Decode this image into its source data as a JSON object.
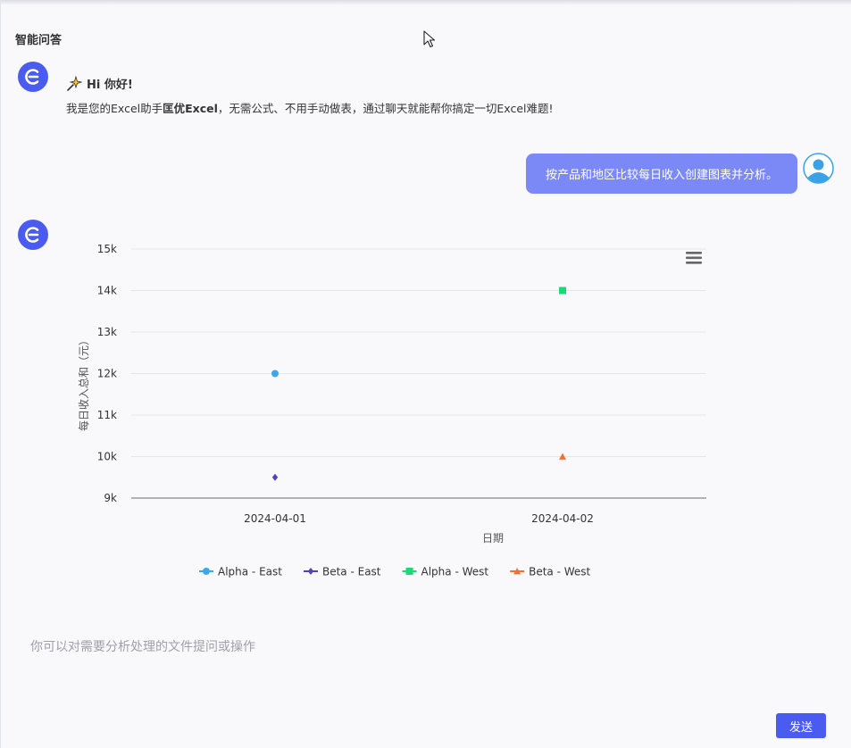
{
  "header": {
    "title": "智能问答"
  },
  "greeting": {
    "title": "Hi 你好!",
    "text_before": "我是您的Excel助手",
    "brand": "匡优Excel",
    "text_after": "，无需公式、不用手动做表，通过聊天就能帮你搞定一切Excel难题!"
  },
  "user_message": {
    "text": "按产品和地区比较每日收入创建图表并分析。"
  },
  "colors": {
    "accent": "#4a5cf0",
    "user_bubble": "#7b89f6"
  },
  "chart_data": {
    "type": "scatter",
    "xlabel": "日期",
    "ylabel": "每日收入总和（元）",
    "categories": [
      "2024-04-01",
      "2024-04-02"
    ],
    "ylim": [
      9000,
      15000
    ],
    "yticks": [
      {
        "value": 9000,
        "label": "9k"
      },
      {
        "value": 10000,
        "label": "10k"
      },
      {
        "value": 11000,
        "label": "11k"
      },
      {
        "value": 12000,
        "label": "12k"
      },
      {
        "value": 13000,
        "label": "13k"
      },
      {
        "value": 14000,
        "label": "14k"
      },
      {
        "value": 15000,
        "label": "15k"
      }
    ],
    "grid": true,
    "legend_position": "bottom",
    "series": [
      {
        "name": "Alpha - East",
        "marker": "circle",
        "color": "#3aa8ea",
        "points": [
          {
            "x": "2024-04-01",
            "y": 12000
          }
        ]
      },
      {
        "name": "Beta - East",
        "marker": "diamond",
        "color": "#4b43c0",
        "points": [
          {
            "x": "2024-04-01",
            "y": 9500
          }
        ]
      },
      {
        "name": "Alpha - West",
        "marker": "square",
        "color": "#1ed877",
        "points": [
          {
            "x": "2024-04-02",
            "y": 14000
          }
        ]
      },
      {
        "name": "Beta - West",
        "marker": "triangle",
        "color": "#f0703a",
        "points": [
          {
            "x": "2024-04-02",
            "y": 10000
          }
        ]
      }
    ]
  },
  "input": {
    "placeholder": "你可以对需要分析处理的文件提问或操作"
  },
  "send_button": {
    "label": "发送"
  }
}
